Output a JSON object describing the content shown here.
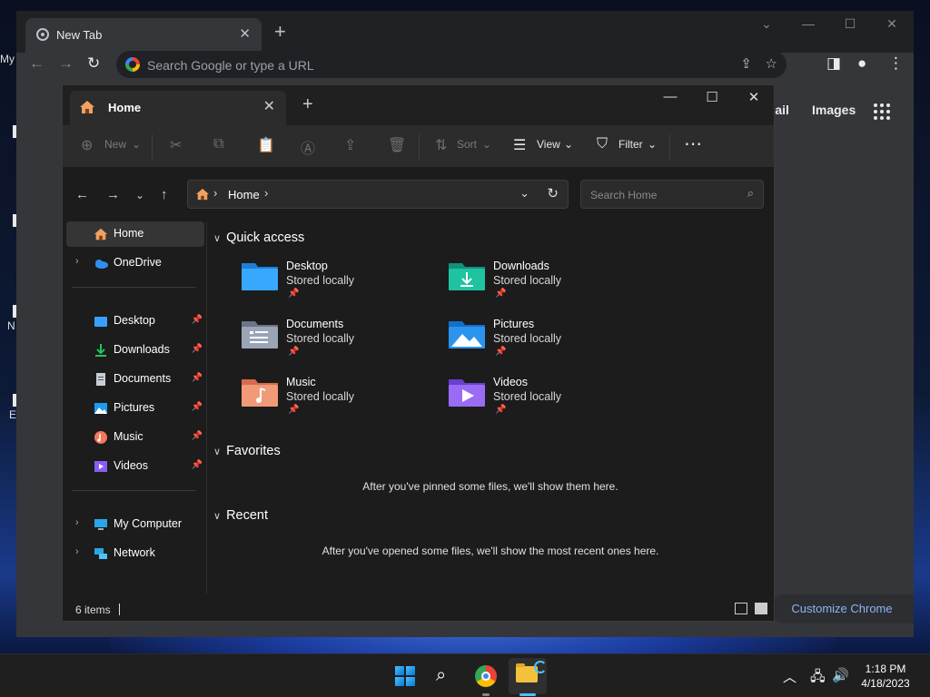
{
  "chrome": {
    "tab_title": "New Tab",
    "omnibox_placeholder": "Search Google or type a URL",
    "links": [
      "Gmail",
      "Images"
    ],
    "customize_label": "Customize Chrome"
  },
  "desktop": {
    "icon_labels": [
      "My",
      "N",
      "E"
    ]
  },
  "explorer": {
    "tab_title": "Home",
    "commands": {
      "new": "New",
      "sort": "Sort",
      "view": "View",
      "filter": "Filter"
    },
    "breadcrumb": "Home",
    "search_placeholder": "Search Home",
    "sidebar": {
      "top": [
        {
          "label": "Home",
          "icon": "home-icon",
          "selected": true
        },
        {
          "label": "OneDrive",
          "icon": "cloud-icon",
          "expandable": true
        }
      ],
      "pinned": [
        {
          "label": "Desktop",
          "icon": "desktop-folder-icon",
          "color": "#3aa0ff"
        },
        {
          "label": "Downloads",
          "icon": "download-icon",
          "color": "#22c55e"
        },
        {
          "label": "Documents",
          "icon": "document-icon",
          "color": "#c9ced6"
        },
        {
          "label": "Pictures",
          "icon": "picture-icon",
          "color": "#1d9bf0"
        },
        {
          "label": "Music",
          "icon": "music-icon",
          "color": "#f07a5a"
        },
        {
          "label": "Videos",
          "icon": "video-icon",
          "color": "#8b5cf6"
        }
      ],
      "bottom": [
        {
          "label": "My Computer",
          "icon": "computer-icon"
        },
        {
          "label": "Network",
          "icon": "network-icon"
        }
      ]
    },
    "sections": {
      "quick_access": "Quick access",
      "favorites": "Favorites",
      "recent": "Recent"
    },
    "quick_access": [
      {
        "name": "Desktop",
        "status": "Stored locally",
        "color": "#2f9bf0"
      },
      {
        "name": "Downloads",
        "status": "Stored locally",
        "color": "#17b89a"
      },
      {
        "name": "Documents",
        "status": "Stored locally",
        "color": "#8c97a8"
      },
      {
        "name": "Pictures",
        "status": "Stored locally",
        "color": "#1d8fe6"
      },
      {
        "name": "Music",
        "status": "Stored locally",
        "color": "#ef8a6a"
      },
      {
        "name": "Videos",
        "status": "Stored locally",
        "color": "#8f5ef0"
      }
    ],
    "favorites_empty": "After you've pinned some files, we'll show them here.",
    "recent_empty": "After you've opened some files, we'll show the most recent ones here.",
    "status_count": "6 items"
  },
  "taskbar": {
    "time": "1:18 PM",
    "date": "4/18/2023"
  },
  "colors": {
    "accent": "#4cc2ff",
    "chrome_link": "#8ab4f8"
  }
}
